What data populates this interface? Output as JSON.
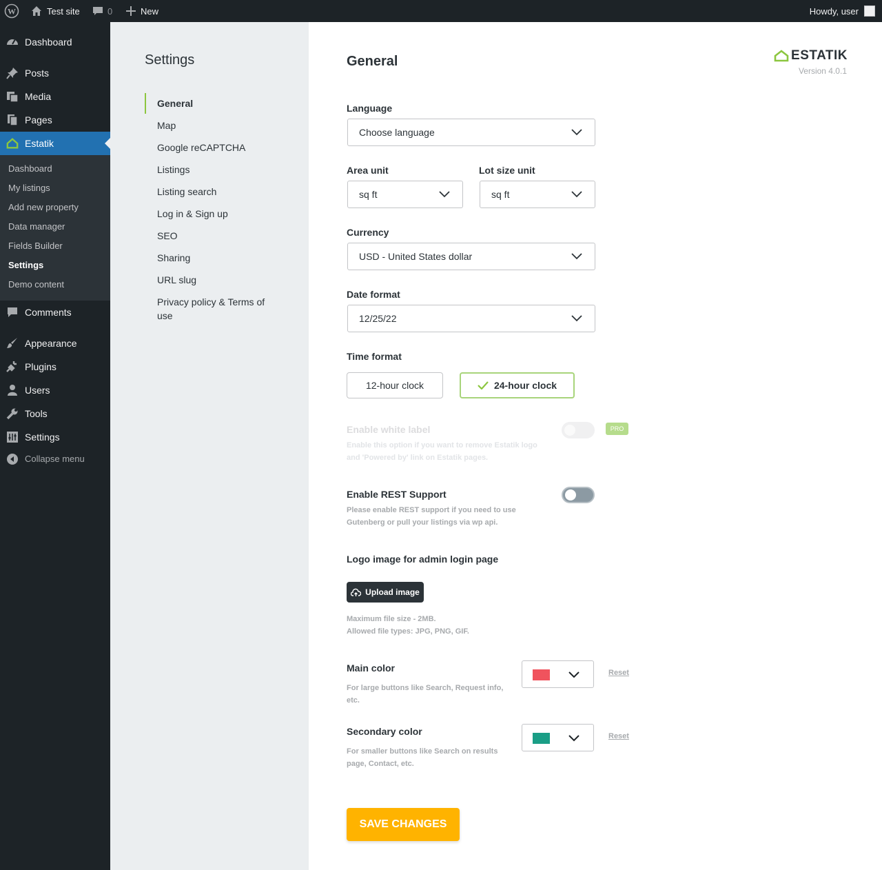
{
  "adminbar": {
    "site_name": "Test site",
    "comments_count": "0",
    "new_label": "New",
    "howdy": "Howdy, user"
  },
  "menu": {
    "items": [
      {
        "label": "Dashboard",
        "icon": "dashboard-icon"
      },
      {
        "label": "Posts",
        "icon": "pin-icon"
      },
      {
        "label": "Media",
        "icon": "media-icon"
      },
      {
        "label": "Pages",
        "icon": "pages-icon"
      },
      {
        "label": "Estatik",
        "icon": "estatik-house-icon"
      },
      {
        "label": "Comments",
        "icon": "comment-icon"
      },
      {
        "label": "Appearance",
        "icon": "brush-icon"
      },
      {
        "label": "Plugins",
        "icon": "plug-icon"
      },
      {
        "label": "Users",
        "icon": "user-icon"
      },
      {
        "label": "Tools",
        "icon": "wrench-icon"
      },
      {
        "label": "Settings",
        "icon": "settings-icon"
      }
    ],
    "submenu": [
      "Dashboard",
      "My listings",
      "Add new property",
      "Data manager",
      "Fields Builder",
      "Settings",
      "Demo content"
    ],
    "collapse": "Collapse menu"
  },
  "settings_nav": {
    "title": "Settings",
    "items": [
      "General",
      "Map",
      "Google reCAPTCHA",
      "Listings",
      "Listing search",
      "Log in & Sign up",
      "SEO",
      "Sharing",
      "URL slug",
      "Privacy policy & Terms of use"
    ]
  },
  "brand": {
    "logo": "ESTATIK",
    "version": "Version 4.0.1",
    "accent_color": "#8cc63f"
  },
  "general": {
    "title": "General",
    "language_label": "Language",
    "language_value": "Choose language",
    "area_unit_label": "Area unit",
    "area_unit_value": "sq ft",
    "lot_size_label": "Lot size unit",
    "lot_size_value": "sq ft",
    "currency_label": "Currency",
    "currency_value": "USD - United States dollar",
    "date_format_label": "Date format",
    "date_format_value": "12/25/22",
    "time_format_label": "Time format",
    "time_12": "12-hour clock",
    "time_24": "24-hour clock",
    "white_label_title": "Enable white label",
    "white_label_desc": "Enable this option if you want to remove Estatik logo and 'Powered by' link on Estatik pages.",
    "pro_badge": "PRO",
    "rest_title": "Enable REST Support",
    "rest_desc": "Please enable REST support if you need to use Gutenberg or pull your listings via wp api.",
    "logo_title": "Logo image for admin login page",
    "upload_label": "Upload image",
    "file_size_note": "Maximum file size - 2MB.",
    "file_types_note": "Allowed file types: JPG, PNG, GIF.",
    "main_color_label": "Main color",
    "main_color_desc": "For large buttons like Search, Request info, etc.",
    "main_color": "#f0535d",
    "secondary_color_label": "Secondary color",
    "secondary_color_desc": "For smaller buttons like Search on results page, Contact, etc.",
    "secondary_color": "#1a9e86",
    "reset_label": "Reset",
    "save_label": "SAVE CHANGES",
    "save_color": "#ffb300"
  }
}
